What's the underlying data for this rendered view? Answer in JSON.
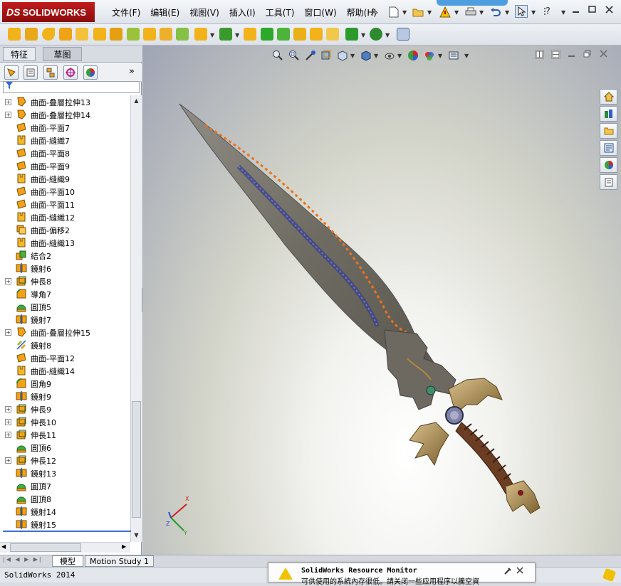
{
  "app": {
    "logo_text": "SOLIDWORKS",
    "logo_prefix": "DS"
  },
  "menu": [
    "文件(F)",
    "编辑(E)",
    "视图(V)",
    "插入(I)",
    "工具(T)",
    "窗口(W)",
    "帮助(H)"
  ],
  "help_symbol": "?",
  "left_panel": {
    "tabs": [
      "特征",
      "草图"
    ],
    "active_tab": "草图",
    "expand_label": "»",
    "tree": [
      {
        "label": "曲面-叠層拉伸13",
        "icon": "loft-surface-icon",
        "expandable": true
      },
      {
        "label": "曲面-叠層拉伸14",
        "icon": "loft-surface-icon",
        "expandable": true
      },
      {
        "label": "曲面-平面7",
        "icon": "planar-surface-icon",
        "expandable": false
      },
      {
        "label": "曲面-縫織7",
        "icon": "knit-surface-icon",
        "expandable": false
      },
      {
        "label": "曲面-平面8",
        "icon": "planar-surface-icon",
        "expandable": false
      },
      {
        "label": "曲面-平面9",
        "icon": "planar-surface-icon",
        "expandable": false
      },
      {
        "label": "曲面-縫織9",
        "icon": "knit-surface-icon",
        "expandable": false
      },
      {
        "label": "曲面-平面10",
        "icon": "planar-surface-icon",
        "expandable": false
      },
      {
        "label": "曲面-平面11",
        "icon": "planar-surface-icon",
        "expandable": false
      },
      {
        "label": "曲面-縫織12",
        "icon": "knit-surface-icon",
        "expandable": false
      },
      {
        "label": "曲面-偏移2",
        "icon": "offset-surface-icon",
        "expandable": false
      },
      {
        "label": "曲面-縫織13",
        "icon": "knit-surface-icon",
        "expandable": false
      },
      {
        "label": "結合2",
        "icon": "combine-icon",
        "expandable": false
      },
      {
        "label": "鏡射6",
        "icon": "mirror-icon",
        "expandable": false
      },
      {
        "label": "伸長8",
        "icon": "extrude-icon",
        "expandable": true
      },
      {
        "label": "導角7",
        "icon": "chamfer-icon",
        "expandable": false
      },
      {
        "label": "圓頂5",
        "icon": "dome-icon",
        "expandable": false
      },
      {
        "label": "鏡射7",
        "icon": "mirror-icon",
        "expandable": false
      },
      {
        "label": "曲面-叠層拉伸15",
        "icon": "loft-surface-icon",
        "expandable": true
      },
      {
        "label": "鏡射8",
        "icon": "mirror-surface-icon",
        "expandable": false
      },
      {
        "label": "曲面-平面12",
        "icon": "planar-surface-icon",
        "expandable": false
      },
      {
        "label": "曲面-縫織14",
        "icon": "knit-surface-icon",
        "expandable": false
      },
      {
        "label": "圓角9",
        "icon": "fillet-icon",
        "expandable": false
      },
      {
        "label": "鏡射9",
        "icon": "mirror-icon",
        "expandable": false
      },
      {
        "label": "伸長9",
        "icon": "extrude-icon",
        "expandable": true
      },
      {
        "label": "伸長10",
        "icon": "extrude-icon",
        "expandable": true
      },
      {
        "label": "伸長11",
        "icon": "extrude-icon",
        "expandable": true
      },
      {
        "label": "圓頂6",
        "icon": "dome-icon",
        "expandable": false
      },
      {
        "label": "伸長12",
        "icon": "extrude-icon",
        "expandable": true
      },
      {
        "label": "鏡射13",
        "icon": "mirror-icon",
        "expandable": false
      },
      {
        "label": "圓頂7",
        "icon": "dome-icon",
        "expandable": false
      },
      {
        "label": "圓頂8",
        "icon": "dome-icon",
        "expandable": false
      },
      {
        "label": "鏡射14",
        "icon": "mirror-icon",
        "expandable": false
      },
      {
        "label": "鏡射15",
        "icon": "mirror-icon",
        "expandable": false
      }
    ]
  },
  "bottom_tabs": [
    "模型",
    "Motion Study 1"
  ],
  "active_bottom_tab": "模型",
  "status": {
    "left_text": "SolidWorks 2014"
  },
  "notification": {
    "title": "SolidWorks Resource Monitor",
    "body": "可供使用的系統內存很低。請关闭一些应用程序以騰空資"
  },
  "colors": {
    "accent_red": "#b3121a",
    "tree_icon_orange": "#f2a21a",
    "selection_blue": "#3b6fd4"
  }
}
